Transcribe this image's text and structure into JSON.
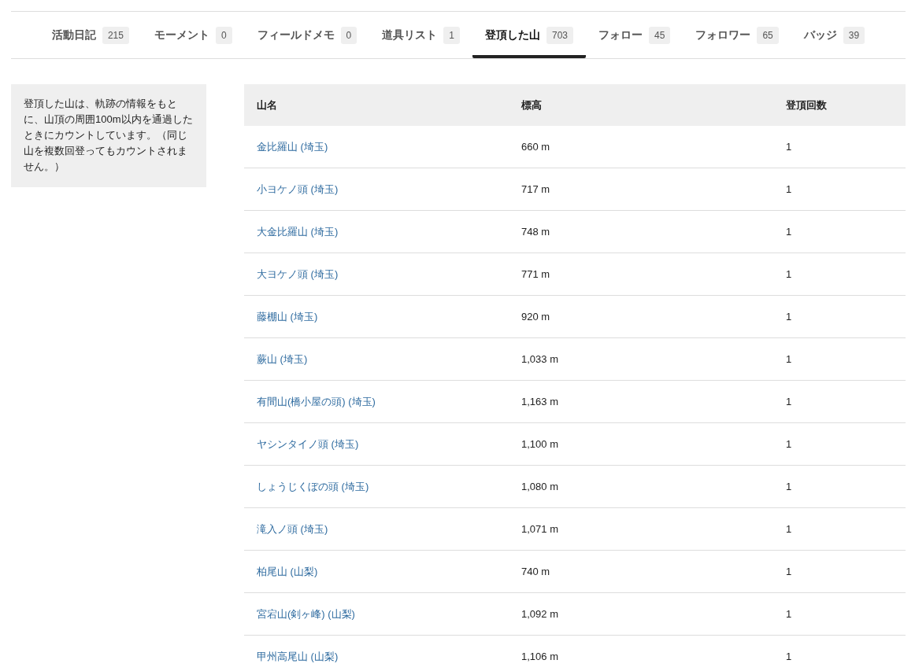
{
  "tabs": [
    {
      "label": "活動日記",
      "count": "215",
      "selected": false
    },
    {
      "label": "モーメント",
      "count": "0",
      "selected": false
    },
    {
      "label": "フィールドメモ",
      "count": "0",
      "selected": false
    },
    {
      "label": "道具リスト",
      "count": "1",
      "selected": false
    },
    {
      "label": "登頂した山",
      "count": "703",
      "selected": true
    },
    {
      "label": "フォロー",
      "count": "45",
      "selected": false
    },
    {
      "label": "フォロワー",
      "count": "65",
      "selected": false
    },
    {
      "label": "バッジ",
      "count": "39",
      "selected": false
    }
  ],
  "info_note": "登頂した山は、軌跡の情報をもとに、山頂の周囲100m以内を通過したときにカウントしています。（同じ山を複数回登ってもカウントされません。）",
  "table": {
    "columns": [
      "山名",
      "標高",
      "登頂回数"
    ],
    "rows": [
      {
        "name": "金比羅山 (埼玉)",
        "elevation": "660 m",
        "count": "1"
      },
      {
        "name": "小ヨケノ頭 (埼玉)",
        "elevation": "717 m",
        "count": "1"
      },
      {
        "name": "大金比羅山 (埼玉)",
        "elevation": "748 m",
        "count": "1"
      },
      {
        "name": "大ヨケノ頭 (埼玉)",
        "elevation": "771 m",
        "count": "1"
      },
      {
        "name": "藤棚山 (埼玉)",
        "elevation": "920 m",
        "count": "1"
      },
      {
        "name": "蕨山 (埼玉)",
        "elevation": "1,033 m",
        "count": "1"
      },
      {
        "name": "有間山(橋小屋の頭) (埼玉)",
        "elevation": "1,163 m",
        "count": "1"
      },
      {
        "name": "ヤシンタイノ頭 (埼玉)",
        "elevation": "1,100 m",
        "count": "1"
      },
      {
        "name": "しょうじくぼの頭 (埼玉)",
        "elevation": "1,080 m",
        "count": "1"
      },
      {
        "name": "滝入ノ頭 (埼玉)",
        "elevation": "1,071 m",
        "count": "1"
      },
      {
        "name": "柏尾山 (山梨)",
        "elevation": "740 m",
        "count": "1"
      },
      {
        "name": "宮宕山(剣ヶ峰) (山梨)",
        "elevation": "1,092 m",
        "count": "1"
      },
      {
        "name": "甲州高尾山 (山梨)",
        "elevation": "1,106 m",
        "count": "1"
      }
    ]
  }
}
